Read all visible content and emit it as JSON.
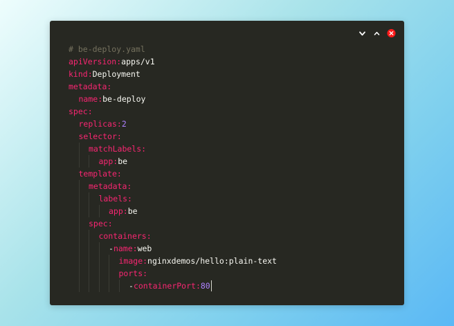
{
  "colors": {
    "background_start": "#eefdfd",
    "background_end": "#5ab8f5",
    "editor_bg": "#272822",
    "comment": "#75715e",
    "key": "#f92672",
    "string": "#f8f8f2",
    "number": "#ae81ff",
    "close_button": "#ff1a1a"
  },
  "window": {
    "controls": [
      {
        "icon": "chevron-down-icon"
      },
      {
        "icon": "chevron-up-icon"
      },
      {
        "icon": "close-icon"
      }
    ]
  },
  "editor": {
    "lines": [
      {
        "indent": 0,
        "dash": "",
        "key": "",
        "value": "",
        "comment": "# be-deploy.yaml"
      },
      {
        "indent": 0,
        "dash": "",
        "key": "apiVersion:",
        "value": "apps/v1",
        "comment": ""
      },
      {
        "indent": 0,
        "dash": "",
        "key": "kind:",
        "value": "Deployment",
        "comment": ""
      },
      {
        "indent": 0,
        "dash": "",
        "key": "metadata:",
        "value": "",
        "comment": ""
      },
      {
        "indent": 1,
        "dash": "",
        "key": "name:",
        "value": "be-deploy",
        "comment": ""
      },
      {
        "indent": 0,
        "dash": "",
        "key": "spec:",
        "value": "",
        "comment": ""
      },
      {
        "indent": 1,
        "dash": "",
        "key": "replicas:",
        "value": "2",
        "comment": "",
        "numeric": true
      },
      {
        "indent": 1,
        "dash": "",
        "key": "selector:",
        "value": "",
        "comment": ""
      },
      {
        "indent": 2,
        "dash": "",
        "key": "matchLabels:",
        "value": "",
        "comment": ""
      },
      {
        "indent": 3,
        "dash": "",
        "key": "app:",
        "value": "be",
        "comment": ""
      },
      {
        "indent": 1,
        "dash": "",
        "key": "template:",
        "value": "",
        "comment": ""
      },
      {
        "indent": 2,
        "dash": "",
        "key": "metadata:",
        "value": "",
        "comment": ""
      },
      {
        "indent": 3,
        "dash": "",
        "key": "labels:",
        "value": "",
        "comment": ""
      },
      {
        "indent": 4,
        "dash": "",
        "key": "app:",
        "value": "be",
        "comment": ""
      },
      {
        "indent": 2,
        "dash": "",
        "key": "spec:",
        "value": "",
        "comment": ""
      },
      {
        "indent": 3,
        "dash": "",
        "key": "containers:",
        "value": "",
        "comment": ""
      },
      {
        "indent": 4,
        "dash": "-",
        "key": "name:",
        "value": "web",
        "comment": ""
      },
      {
        "indent": 5,
        "dash": "",
        "key": "image:",
        "value": "nginxdemos/hello:plain-text",
        "comment": ""
      },
      {
        "indent": 5,
        "dash": "",
        "key": "ports:",
        "value": "",
        "comment": ""
      },
      {
        "indent": 6,
        "dash": "-",
        "key": "containerPort:",
        "value": "80",
        "comment": "",
        "numeric": true,
        "cursor": true
      }
    ]
  }
}
